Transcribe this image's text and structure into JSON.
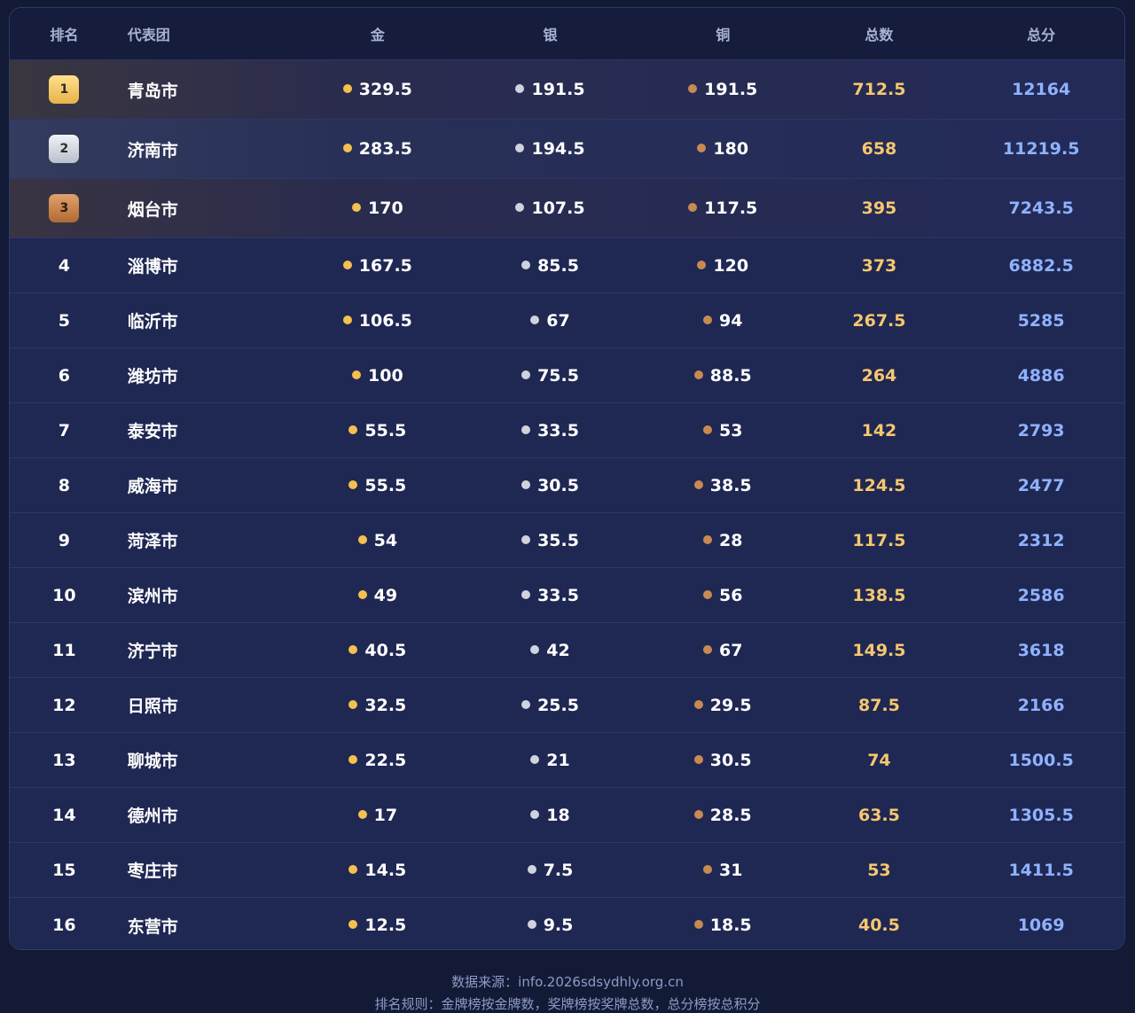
{
  "table": {
    "headers": {
      "rank": "排名",
      "city": "代表团",
      "gold": "金",
      "silver": "银",
      "bronze": "铜",
      "total": "总数",
      "score": "总分"
    },
    "rows": [
      {
        "rank": "1",
        "city": "青岛市",
        "gold": "329.5",
        "silver": "191.5",
        "bronze": "191.5",
        "total": "712.5",
        "score": "12164"
      },
      {
        "rank": "2",
        "city": "济南市",
        "gold": "283.5",
        "silver": "194.5",
        "bronze": "180",
        "total": "658",
        "score": "11219.5"
      },
      {
        "rank": "3",
        "city": "烟台市",
        "gold": "170",
        "silver": "107.5",
        "bronze": "117.5",
        "total": "395",
        "score": "7243.5"
      },
      {
        "rank": "4",
        "city": "淄博市",
        "gold": "167.5",
        "silver": "85.5",
        "bronze": "120",
        "total": "373",
        "score": "6882.5"
      },
      {
        "rank": "5",
        "city": "临沂市",
        "gold": "106.5",
        "silver": "67",
        "bronze": "94",
        "total": "267.5",
        "score": "5285"
      },
      {
        "rank": "6",
        "city": "潍坊市",
        "gold": "100",
        "silver": "75.5",
        "bronze": "88.5",
        "total": "264",
        "score": "4886"
      },
      {
        "rank": "7",
        "city": "泰安市",
        "gold": "55.5",
        "silver": "33.5",
        "bronze": "53",
        "total": "142",
        "score": "2793"
      },
      {
        "rank": "8",
        "city": "威海市",
        "gold": "55.5",
        "silver": "30.5",
        "bronze": "38.5",
        "total": "124.5",
        "score": "2477"
      },
      {
        "rank": "9",
        "city": "菏泽市",
        "gold": "54",
        "silver": "35.5",
        "bronze": "28",
        "total": "117.5",
        "score": "2312"
      },
      {
        "rank": "10",
        "city": "滨州市",
        "gold": "49",
        "silver": "33.5",
        "bronze": "56",
        "total": "138.5",
        "score": "2586"
      },
      {
        "rank": "11",
        "city": "济宁市",
        "gold": "40.5",
        "silver": "42",
        "bronze": "67",
        "total": "149.5",
        "score": "3618"
      },
      {
        "rank": "12",
        "city": "日照市",
        "gold": "32.5",
        "silver": "25.5",
        "bronze": "29.5",
        "total": "87.5",
        "score": "2166"
      },
      {
        "rank": "13",
        "city": "聊城市",
        "gold": "22.5",
        "silver": "21",
        "bronze": "30.5",
        "total": "74",
        "score": "1500.5"
      },
      {
        "rank": "14",
        "city": "德州市",
        "gold": "17",
        "silver": "18",
        "bronze": "28.5",
        "total": "63.5",
        "score": "1305.5"
      },
      {
        "rank": "15",
        "city": "枣庄市",
        "gold": "14.5",
        "silver": "7.5",
        "bronze": "31",
        "total": "53",
        "score": "1411.5"
      },
      {
        "rank": "16",
        "city": "东营市",
        "gold": "12.5",
        "silver": "9.5",
        "bronze": "18.5",
        "total": "40.5",
        "score": "1069"
      }
    ]
  },
  "footer": {
    "source": "数据来源：info.2026sdsydhly.org.cn",
    "rule": "排名规则：金牌榜按金牌数，奖牌榜按奖牌总数，总分榜按总积分"
  },
  "colors": {
    "background": "#121a36",
    "panel": "#1e2650",
    "gold_dot": "#f4c04f",
    "silver_dot": "#cfd3de",
    "bronze_dot": "#c98a52",
    "total_text": "#f5c76e",
    "score_text": "#8fb2ff"
  }
}
